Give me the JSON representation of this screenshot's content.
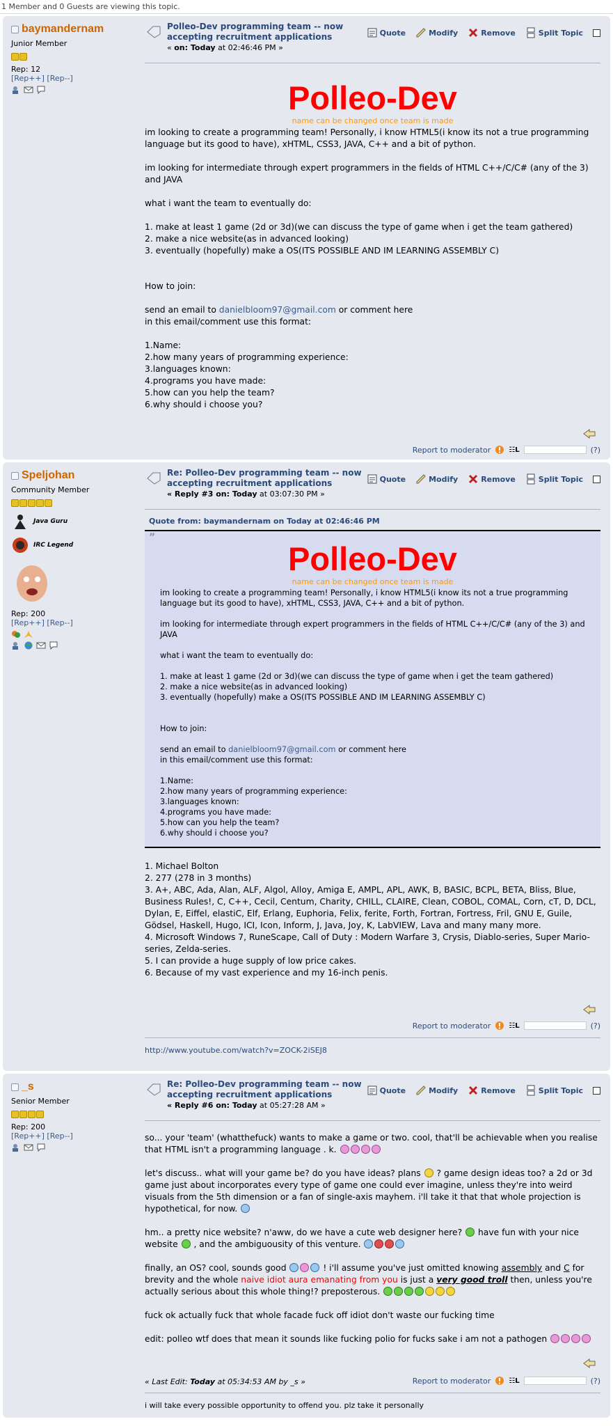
{
  "viewing": "1 Member and 0 Guests are viewing this topic.",
  "common": {
    "actions": [
      "Quote",
      "Modify",
      "Remove",
      "Split Topic"
    ],
    "report": "Report to moderator",
    "ip_help": "(?)",
    "rep_links": "[Rep++] [Rep--]",
    "on_label": "on:",
    "on_word": "on:",
    "quote_mark": "”"
  },
  "post1": {
    "username": "baymandernam",
    "rank": "Junior Member",
    "rep": "Rep: 12",
    "subject": "Polleo-Dev programming team -- now accepting recruitment applications",
    "date_prefix": "« ",
    "date_on": "on: Today",
    "date_time": " at 02:46:46 PM »",
    "title": "Polleo-Dev",
    "subtitle": "name can be changed once team is made",
    "p1": "im looking to create a programming team! Personally, i know HTML5(i know its not a true programming language but its good to have), xHTML, CSS3, JAVA, C++ and a bit of python.",
    "p2": "im looking for intermediate through expert programmers in the fields of HTML C++/C/C# (any of the 3) and JAVA",
    "p3": "what i want the team to eventually do:",
    "l1": "1. make at least 1 game (2d or 3d)(we can discuss the type of game when i get the team gathered)",
    "l2": "2. make a nice website(as in advanced looking)",
    "l3": "3. eventually (hopefully) make a OS(ITS POSSIBLE AND IM LEARNING ASSEMBLY C)",
    "p4": "How to join:",
    "email_pre": "send an email to ",
    "email": "danielbloom97@gmail.com",
    "email_post": " or comment here",
    "format": "in this email/comment use this format:",
    "f1": "1.Name:",
    "f2": "2.how many years of programming experience:",
    "f3": "3.languages known:",
    "f4": "4.programs you have made:",
    "f5": "5.how can you help the team?",
    "f6": "6.why should i choose you?"
  },
  "post2": {
    "username": "Speljohan",
    "rank": "Community Member",
    "award1": "Java Guru",
    "award2": "IRC Legend",
    "rep": "Rep: 200",
    "subject": "Re: Polleo-Dev programming team -- now accepting recruitment applications",
    "date_reply": "« Reply #3 on: Today",
    "date_time": " at 03:07:30 PM »",
    "quote_from": "Quote from: baymandernam on Today at 02:46:46 PM",
    "a1": "1. Michael Bolton",
    "a2": "2. 277 (278 in 3 months)",
    "a3": "3. A+, ABC, Ada, Alan, ALF, Algol, Alloy, Amiga E, AMPL, APL, AWK, B, BASIC, BCPL, BETA, Bliss, Blue, Business Rules!, C, C++, Cecil, Centum, Charity, CHILL, CLAIRE, Clean, COBOL, COMAL, Corn, cT, D, DCL, Dylan, E, Eiffel, elastiC, Elf, Erlang, Euphoria, Felix, ferite, Forth, Fortran, Fortress, Fril, GNU E, Guile, Gödsel, Haskell, Hugo, ICI, Icon, Inform, J, Java, Joy, K, LabVIEW, Lava and many many more.",
    "a4": "4. Microsoft Windows 7, RuneScape, Call of Duty : Modern Warfare 3, Crysis, Diablo-series, Super Mario-series, Zelda-series.",
    "a5": "5. I can provide a huge supply of low price cakes.",
    "a6": "6. Because of my vast experience and my 16-inch penis.",
    "sig": "http://www.youtube.com/watch?v=ZOCK-2iSEJ8"
  },
  "post3": {
    "username": "_s",
    "rank": "Senior Member",
    "rep": "Rep: 200",
    "subject": "Re: Polleo-Dev programming team -- now accepting recruitment applications",
    "date_reply": "« Reply #6 on: Today",
    "date_time": " at 05:27:28 AM »",
    "p1": "so... your 'team' (whatthefuck) wants to make a game or two. cool, that'll be achievable when you realise that HTML isn't a programming language . k.",
    "p2a": "let's discuss.. what will your game be? do you have ideas? plans",
    "p2b": "? game design ideas too? a 2d or 3d game just about incorporates every type of game one could ever imagine, unless they're into weird visuals from the 5th dimension or a fan of single-axis mayhem. i'll take it that that whole projection is hypothetical, for now.",
    "p3a": "hm.. a pretty nice website? n'aww, do we have a cute web designer here?",
    "p3b": "have fun with your nice website",
    "p3c": ", and the ambiguousity of this venture.",
    "p4a": "finally, an OS? cool, sounds good",
    "p4b": "! i'll assume you've just omitted knowing",
    "p4c": "assembly",
    "p4d": "and",
    "p4e": "C",
    "p4f": "for brevity and the whole",
    "p4g": "naive idiot aura emanating from you",
    "p4h": "is just a",
    "p4i": "very good troll",
    "p4j": "then, unless you're actually serious about this whole thing!? preposterous.",
    "p5": "fuck ok actually fuck that whole facade fuck off idiot don't waste our fucking time",
    "p6": "edit: polleo wtf does that mean it sounds like fucking polio for fucks sake i am not a pathogen",
    "edit_pre": "« Last Edit: ",
    "edit_today": "Today",
    "edit_post": " at 05:34:53 AM by _s »",
    "sig": "i will take every possible opportunity to offend you. plz take it personally"
  }
}
